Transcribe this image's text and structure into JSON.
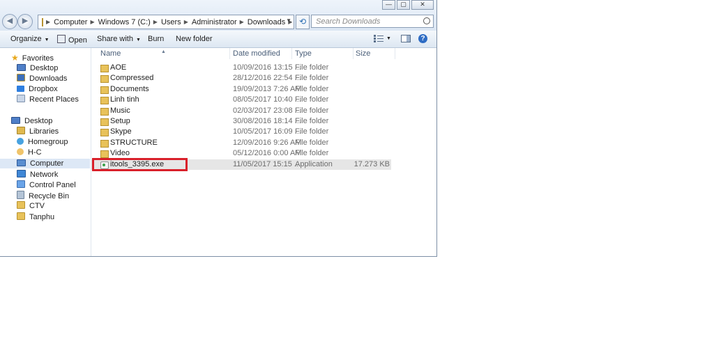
{
  "window": {
    "controls": [
      "—",
      "▢",
      "✕"
    ]
  },
  "address": {
    "crumbs": [
      "Computer",
      "Windows 7 (C:)",
      "Users",
      "Administrator",
      "Downloads"
    ]
  },
  "search": {
    "placeholder": "Search Downloads"
  },
  "toolbar": {
    "organize": "Organize",
    "open": "Open",
    "share_with": "Share with",
    "burn": "Burn",
    "new_folder": "New folder",
    "help": "?"
  },
  "nav": {
    "favorites": "Favorites",
    "fav_items": [
      "Desktop",
      "Downloads",
      "Dropbox",
      "Recent Places"
    ],
    "desktop": "Desktop",
    "desk_items": [
      "Libraries",
      "Homegroup",
      "H-C",
      "Computer",
      "Network",
      "Control Panel",
      "Recycle Bin",
      "CTV",
      "Tanphu"
    ]
  },
  "columns": {
    "name": "Name",
    "date": "Date modified",
    "type": "Type",
    "size": "Size"
  },
  "files": [
    {
      "name": "AOE",
      "date": "10/09/2016 13:15 ...",
      "type": "File folder",
      "size": ""
    },
    {
      "name": "Compressed",
      "date": "28/12/2016 22:54 ...",
      "type": "File folder",
      "size": ""
    },
    {
      "name": "Documents",
      "date": "19/09/2013 7:26 AM",
      "type": "File folder",
      "size": ""
    },
    {
      "name": "Linh tinh",
      "date": "08/05/2017 10:40 ...",
      "type": "File folder",
      "size": ""
    },
    {
      "name": "Music",
      "date": "02/03/2017 23:08 ...",
      "type": "File folder",
      "size": ""
    },
    {
      "name": "Setup",
      "date": "30/08/2016 18:14 ...",
      "type": "File folder",
      "size": ""
    },
    {
      "name": "Skype",
      "date": "10/05/2017 16:09 ...",
      "type": "File folder",
      "size": ""
    },
    {
      "name": "STRUCTURE",
      "date": "12/09/2016 9:26 AM",
      "type": "File folder",
      "size": ""
    },
    {
      "name": "Video",
      "date": "05/12/2016 0:00 AM",
      "type": "File folder",
      "size": ""
    },
    {
      "name": "itools_3395.exe",
      "date": "11/05/2017 15:15 ...",
      "type": "Application",
      "size": "17.273 KB"
    }
  ],
  "colors": {
    "highlight_box": "#d9202a",
    "selected_row": "#e6e6e6"
  }
}
